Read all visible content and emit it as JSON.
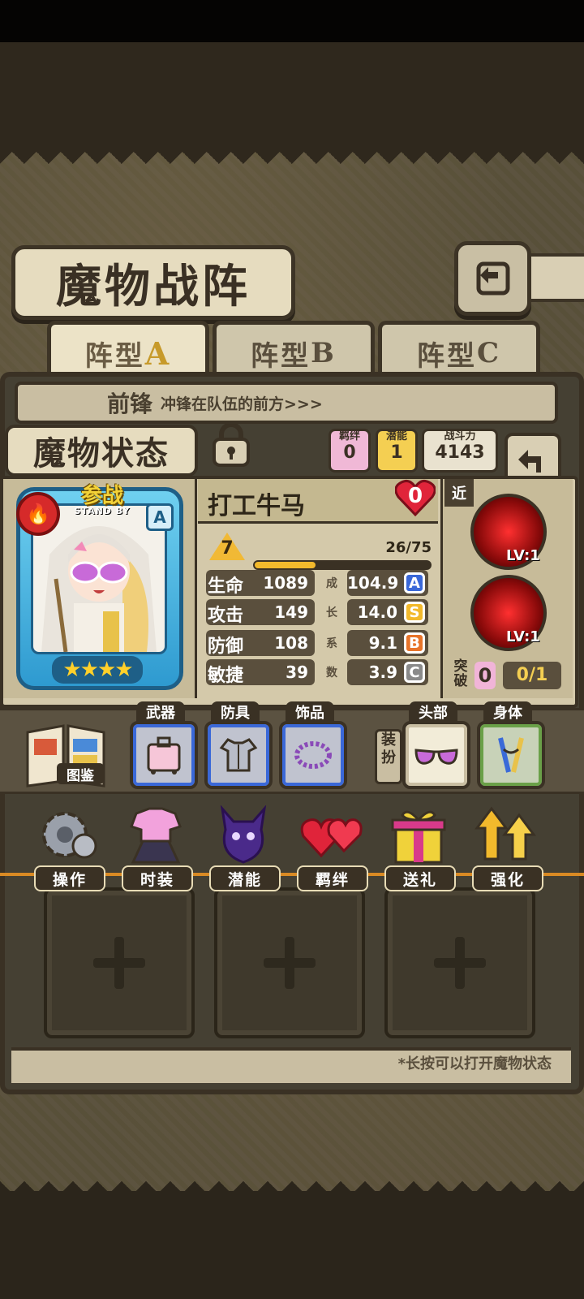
{
  "header": {
    "title": "魔物战阵",
    "back_icon": "return-icon"
  },
  "formation_tabs": [
    {
      "label": "阵型",
      "letter": "A",
      "active": true
    },
    {
      "label": "阵型",
      "letter": "B",
      "active": false
    },
    {
      "label": "阵型",
      "letter": "C",
      "active": false
    }
  ],
  "vanguard": {
    "title": "前锋",
    "desc": "冲锋在队伍的前方>>>"
  },
  "status": {
    "title": "魔物状态",
    "bond_label": "羁绊",
    "bond_value": "0",
    "potential_label": "潜能",
    "potential_value": "1",
    "power_label": "战斗力",
    "power_value": "4143"
  },
  "character": {
    "standby_label": "参战",
    "standby_sub": "STAND BY",
    "rank": "A",
    "stars": 4,
    "name": "打工牛马",
    "heart_value": "0",
    "level": "7",
    "xp_text": "26/75",
    "xp_fraction": 0.3467,
    "growth_chars": [
      "成",
      "长",
      "系",
      "数"
    ]
  },
  "stats": [
    {
      "label": "生命",
      "value": "1089",
      "growth": "104.9",
      "grade": "A",
      "grade_color": "#3a68d8"
    },
    {
      "label": "攻击",
      "value": "149",
      "growth": "14.0",
      "grade": "S",
      "grade_color": "#f2b92c"
    },
    {
      "label": "防御",
      "value": "108",
      "growth": "9.1",
      "grade": "B",
      "grade_color": "#e8742a"
    },
    {
      "label": "敏捷",
      "value": "39",
      "growth": "3.9",
      "grade": "C",
      "grade_color": "#8a8a8a"
    }
  ],
  "skills": {
    "range": "近",
    "items": [
      {
        "level": "LV:1"
      },
      {
        "level": "LV:1"
      }
    ],
    "break_label": "突破",
    "break_count": "0",
    "break_progress": "0/1"
  },
  "equipment": {
    "codex_label": "图鉴",
    "dressup_label": "装扮",
    "slots": [
      {
        "label": "武器",
        "icon": "suitcase-icon"
      },
      {
        "label": "防具",
        "icon": "armor-icon"
      },
      {
        "label": "饰品",
        "icon": "bead-necklace-icon"
      },
      {
        "label": "头部",
        "icon": "sunglasses-icon"
      },
      {
        "label": "身体",
        "icon": "ribbon-icon"
      }
    ]
  },
  "actions": [
    {
      "label": "操作",
      "icon": "gear-icon"
    },
    {
      "label": "时装",
      "icon": "outfit-icon"
    },
    {
      "label": "潜能",
      "icon": "demon-icon"
    },
    {
      "label": "羁绊",
      "icon": "hearts-icon"
    },
    {
      "label": "送礼",
      "icon": "gift-icon"
    },
    {
      "label": "强化",
      "icon": "upgrade-arrows-icon"
    }
  ],
  "hint": "*长按可以打开魔物状态",
  "colors": {
    "accent_gold": "#f2b92c",
    "panel_bg": "#d4c9aa",
    "frame_dark": "#3a3124"
  }
}
